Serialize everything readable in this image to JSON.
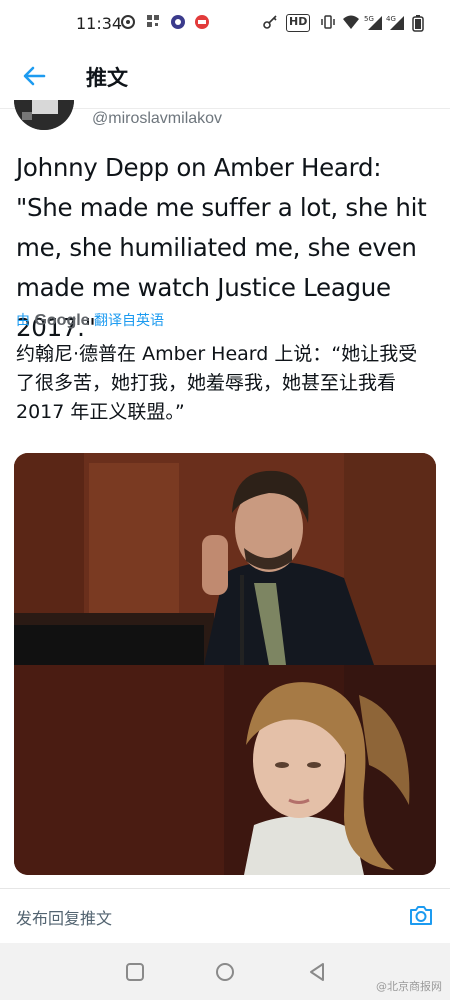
{
  "status_bar": {
    "time": "11:34",
    "icons": [
      "weibo-icon",
      "qr-icon",
      "vpn-icon",
      "app-icon",
      "key-icon",
      "hd-icon",
      "vibrate-icon",
      "wifi-icon",
      "signal-5g-icon",
      "signal-4g-icon",
      "battery-icon"
    ],
    "hd_label": "HD",
    "net1": "5G",
    "net2": "4G"
  },
  "app_bar": {
    "title": "推文"
  },
  "tweet": {
    "handle": "@miroslavmilakov",
    "text": "Johnny Depp on Amber Heard: \"She made me suffer a lot, she hit me, she humiliated me, she even made me watch Justice League 2017.\"",
    "translate_prefix": "由",
    "translate_brand": "Google",
    "translate_suffix": "翻译自英语",
    "translated_text": "约翰尼·德普在 Amber Heard 上说：“她让我受了很多苦，她打我，她羞辱我，她甚至让我看 2017 年正义联盟。”"
  },
  "reply_bar": {
    "placeholder": "发布回复推文"
  },
  "watermark": "@北京商报网"
}
